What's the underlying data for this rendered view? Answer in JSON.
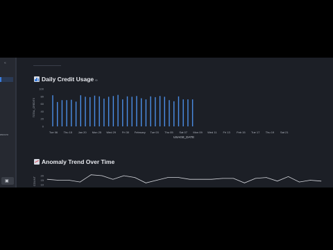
{
  "sidebar": {
    "top_mark": "«",
    "text_fragment": "ascuro",
    "button_icon": "panel-icon"
  },
  "sections": [
    {
      "title": "Daily Credit Usage",
      "icon": "bar-chart-icon"
    },
    {
      "title": "Anomaly Trend Over Time",
      "icon": "trend-chart-icon"
    }
  ],
  "colors": {
    "bar": "#4b8fe8",
    "line": "#d8dae0",
    "background": "#1c1f26"
  },
  "chart_data": [
    {
      "type": "bar",
      "xlabel": "USAGE_DATE",
      "ylabel": "TOTAL_CREDITS",
      "ylim": [
        0,
        100
      ],
      "y_ticks": [
        0,
        20,
        40,
        60,
        80,
        100
      ],
      "x_tick_labels": [
        "Tue 06",
        "Thu 15",
        "Jan 20",
        "Mon 25",
        "Wed 29",
        "Fri 30",
        "February",
        "Tue 03",
        "Thu 05",
        "Sat 07",
        "Mon 09",
        "Wed 11",
        "Fri 13",
        "Feb 15",
        "Tue 17",
        "Thu 19",
        "Sat 21"
      ],
      "values": [
        83,
        65,
        70,
        70,
        71,
        66,
        83,
        79,
        78,
        82,
        80,
        74,
        79,
        81,
        84,
        72,
        80,
        79,
        81,
        75,
        72,
        80,
        78,
        81,
        79,
        70,
        67,
        80,
        72,
        72,
        72
      ]
    },
    {
      "type": "line",
      "ylabel": "COUNT",
      "y_ticks": [
        10,
        15,
        20
      ],
      "values": [
        16,
        15,
        15,
        13,
        21,
        20,
        16,
        20,
        18,
        12,
        15,
        18,
        18,
        16,
        16,
        16,
        17,
        17,
        12,
        17,
        18,
        14,
        19,
        13,
        15,
        14
      ]
    }
  ]
}
